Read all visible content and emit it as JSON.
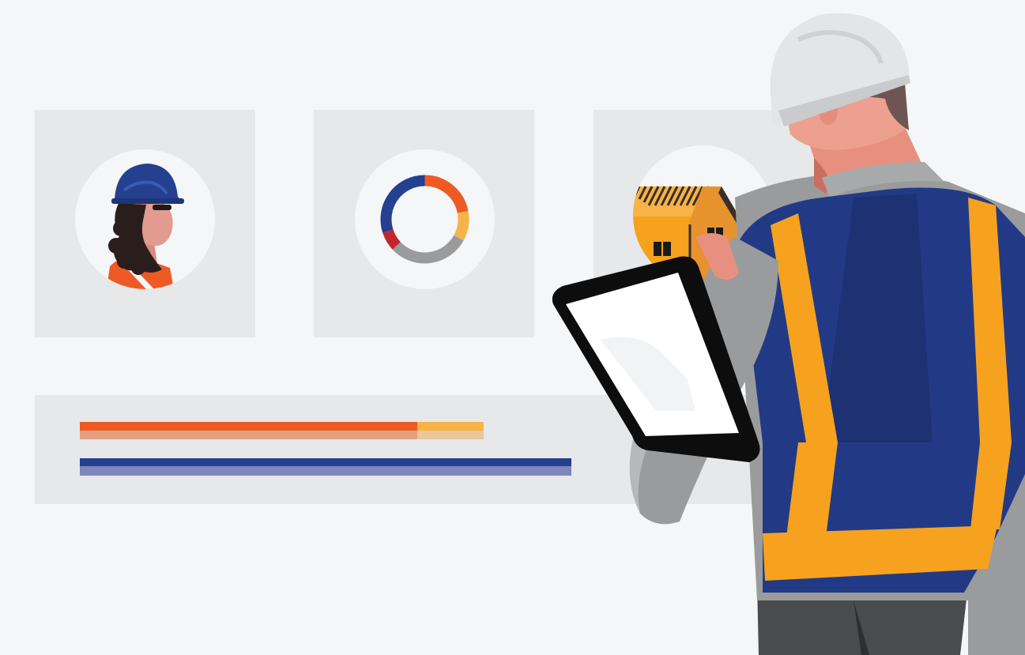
{
  "illustration": {
    "scene": "dashboard-inspection",
    "icons": {
      "worker_avatar": "worker-avatar-icon",
      "donut_chart": "donut-chart-icon",
      "house": "house-icon",
      "tablet": "tablet-icon",
      "inspector": "inspector-figure"
    },
    "progress": {
      "orange_bar_fraction": 0.83,
      "blue_bar_fraction": 1.0
    },
    "donut_segments": [
      {
        "name": "orange",
        "value": 22,
        "color": "#ee5a24"
      },
      {
        "name": "amber",
        "value": 11,
        "color": "#f7b347"
      },
      {
        "name": "gray",
        "value": 30,
        "color": "#9a9b9d"
      },
      {
        "name": "red",
        "value": 7,
        "color": "#c1272d"
      },
      {
        "name": "blue",
        "value": 30,
        "color": "#25408f"
      }
    ],
    "colors": {
      "background": "#f4f6f8",
      "card": "#e6e8ea",
      "orange": "#ee5a24",
      "amber": "#f7b347",
      "navy": "#25408f",
      "vest_yellow": "#f6a21e",
      "helmet": "#e3e5e7"
    }
  }
}
